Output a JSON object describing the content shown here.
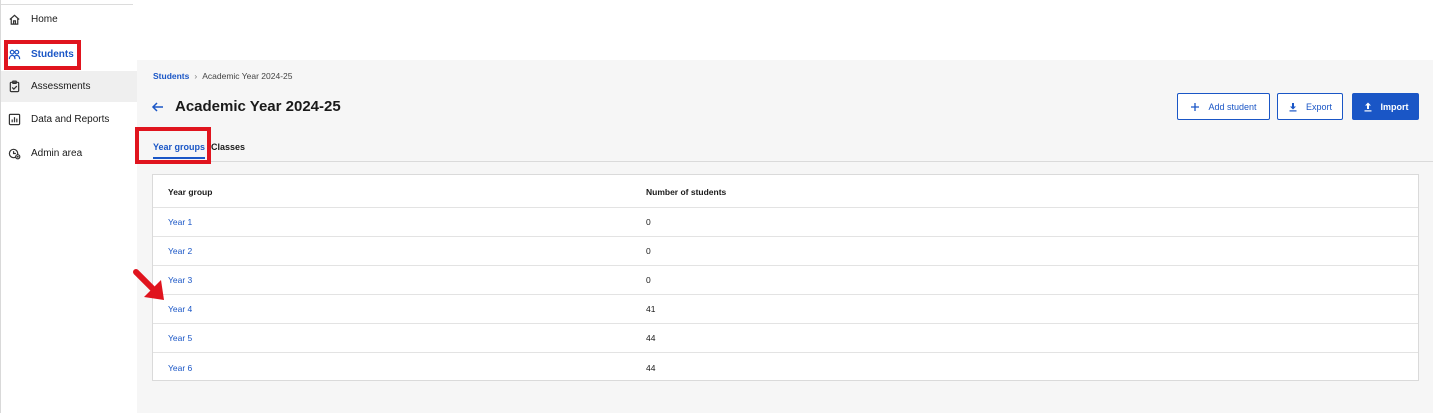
{
  "sidebar": {
    "items": [
      {
        "label": "Home",
        "icon": "home-icon"
      },
      {
        "label": "Students",
        "icon": "students-icon"
      },
      {
        "label": "Assessments",
        "icon": "clipboard-icon"
      },
      {
        "label": "Data and Reports",
        "icon": "chart-icon"
      },
      {
        "label": "Admin area",
        "icon": "admin-icon"
      }
    ]
  },
  "breadcrumb": {
    "root": "Students",
    "separator": "›",
    "current": "Academic Year 2024-25"
  },
  "header": {
    "title": "Academic Year 2024-25",
    "add_student_label": "Add student",
    "export_label": "Export",
    "import_label": "Import"
  },
  "tabs": [
    {
      "label": "Year groups",
      "active": true
    },
    {
      "label": "Classes",
      "active": false
    }
  ],
  "table": {
    "columns": [
      "Year group",
      "Number of students"
    ],
    "rows": [
      {
        "year_group": "Year 1",
        "students": "0"
      },
      {
        "year_group": "Year 2",
        "students": "0"
      },
      {
        "year_group": "Year 3",
        "students": "0"
      },
      {
        "year_group": "Year 4",
        "students": "41"
      },
      {
        "year_group": "Year 5",
        "students": "44"
      },
      {
        "year_group": "Year 6",
        "students": "44"
      }
    ]
  },
  "colors": {
    "accent": "#1a56c6",
    "highlight": "#e0141e"
  }
}
